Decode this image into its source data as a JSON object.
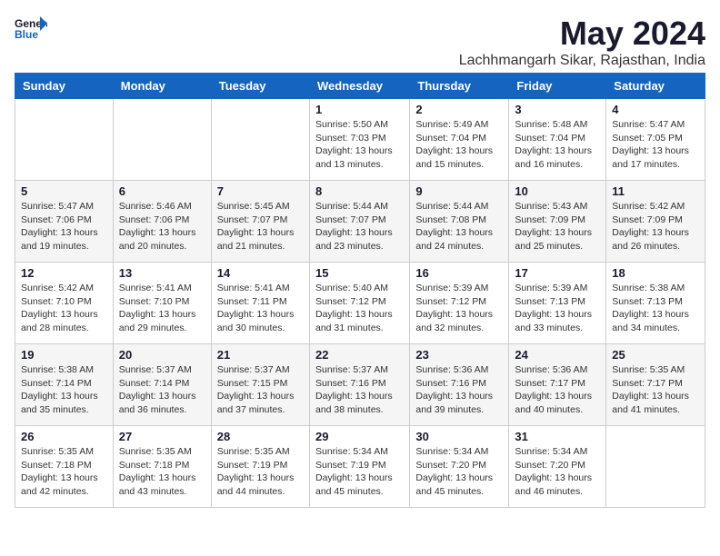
{
  "header": {
    "logo_general": "General",
    "logo_blue": "Blue",
    "title": "May 2024",
    "location": "Lachhmangarh Sikar, Rajasthan, India"
  },
  "calendar": {
    "days_of_week": [
      "Sunday",
      "Monday",
      "Tuesday",
      "Wednesday",
      "Thursday",
      "Friday",
      "Saturday"
    ],
    "weeks": [
      [
        {
          "day": "",
          "info": ""
        },
        {
          "day": "",
          "info": ""
        },
        {
          "day": "",
          "info": ""
        },
        {
          "day": "1",
          "info": "Sunrise: 5:50 AM\nSunset: 7:03 PM\nDaylight: 13 hours\nand 13 minutes."
        },
        {
          "day": "2",
          "info": "Sunrise: 5:49 AM\nSunset: 7:04 PM\nDaylight: 13 hours\nand 15 minutes."
        },
        {
          "day": "3",
          "info": "Sunrise: 5:48 AM\nSunset: 7:04 PM\nDaylight: 13 hours\nand 16 minutes."
        },
        {
          "day": "4",
          "info": "Sunrise: 5:47 AM\nSunset: 7:05 PM\nDaylight: 13 hours\nand 17 minutes."
        }
      ],
      [
        {
          "day": "5",
          "info": "Sunrise: 5:47 AM\nSunset: 7:06 PM\nDaylight: 13 hours\nand 19 minutes."
        },
        {
          "day": "6",
          "info": "Sunrise: 5:46 AM\nSunset: 7:06 PM\nDaylight: 13 hours\nand 20 minutes."
        },
        {
          "day": "7",
          "info": "Sunrise: 5:45 AM\nSunset: 7:07 PM\nDaylight: 13 hours\nand 21 minutes."
        },
        {
          "day": "8",
          "info": "Sunrise: 5:44 AM\nSunset: 7:07 PM\nDaylight: 13 hours\nand 23 minutes."
        },
        {
          "day": "9",
          "info": "Sunrise: 5:44 AM\nSunset: 7:08 PM\nDaylight: 13 hours\nand 24 minutes."
        },
        {
          "day": "10",
          "info": "Sunrise: 5:43 AM\nSunset: 7:09 PM\nDaylight: 13 hours\nand 25 minutes."
        },
        {
          "day": "11",
          "info": "Sunrise: 5:42 AM\nSunset: 7:09 PM\nDaylight: 13 hours\nand 26 minutes."
        }
      ],
      [
        {
          "day": "12",
          "info": "Sunrise: 5:42 AM\nSunset: 7:10 PM\nDaylight: 13 hours\nand 28 minutes."
        },
        {
          "day": "13",
          "info": "Sunrise: 5:41 AM\nSunset: 7:10 PM\nDaylight: 13 hours\nand 29 minutes."
        },
        {
          "day": "14",
          "info": "Sunrise: 5:41 AM\nSunset: 7:11 PM\nDaylight: 13 hours\nand 30 minutes."
        },
        {
          "day": "15",
          "info": "Sunrise: 5:40 AM\nSunset: 7:12 PM\nDaylight: 13 hours\nand 31 minutes."
        },
        {
          "day": "16",
          "info": "Sunrise: 5:39 AM\nSunset: 7:12 PM\nDaylight: 13 hours\nand 32 minutes."
        },
        {
          "day": "17",
          "info": "Sunrise: 5:39 AM\nSunset: 7:13 PM\nDaylight: 13 hours\nand 33 minutes."
        },
        {
          "day": "18",
          "info": "Sunrise: 5:38 AM\nSunset: 7:13 PM\nDaylight: 13 hours\nand 34 minutes."
        }
      ],
      [
        {
          "day": "19",
          "info": "Sunrise: 5:38 AM\nSunset: 7:14 PM\nDaylight: 13 hours\nand 35 minutes."
        },
        {
          "day": "20",
          "info": "Sunrise: 5:37 AM\nSunset: 7:14 PM\nDaylight: 13 hours\nand 36 minutes."
        },
        {
          "day": "21",
          "info": "Sunrise: 5:37 AM\nSunset: 7:15 PM\nDaylight: 13 hours\nand 37 minutes."
        },
        {
          "day": "22",
          "info": "Sunrise: 5:37 AM\nSunset: 7:16 PM\nDaylight: 13 hours\nand 38 minutes."
        },
        {
          "day": "23",
          "info": "Sunrise: 5:36 AM\nSunset: 7:16 PM\nDaylight: 13 hours\nand 39 minutes."
        },
        {
          "day": "24",
          "info": "Sunrise: 5:36 AM\nSunset: 7:17 PM\nDaylight: 13 hours\nand 40 minutes."
        },
        {
          "day": "25",
          "info": "Sunrise: 5:35 AM\nSunset: 7:17 PM\nDaylight: 13 hours\nand 41 minutes."
        }
      ],
      [
        {
          "day": "26",
          "info": "Sunrise: 5:35 AM\nSunset: 7:18 PM\nDaylight: 13 hours\nand 42 minutes."
        },
        {
          "day": "27",
          "info": "Sunrise: 5:35 AM\nSunset: 7:18 PM\nDaylight: 13 hours\nand 43 minutes."
        },
        {
          "day": "28",
          "info": "Sunrise: 5:35 AM\nSunset: 7:19 PM\nDaylight: 13 hours\nand 44 minutes."
        },
        {
          "day": "29",
          "info": "Sunrise: 5:34 AM\nSunset: 7:19 PM\nDaylight: 13 hours\nand 45 minutes."
        },
        {
          "day": "30",
          "info": "Sunrise: 5:34 AM\nSunset: 7:20 PM\nDaylight: 13 hours\nand 45 minutes."
        },
        {
          "day": "31",
          "info": "Sunrise: 5:34 AM\nSunset: 7:20 PM\nDaylight: 13 hours\nand 46 minutes."
        },
        {
          "day": "",
          "info": ""
        }
      ]
    ]
  }
}
